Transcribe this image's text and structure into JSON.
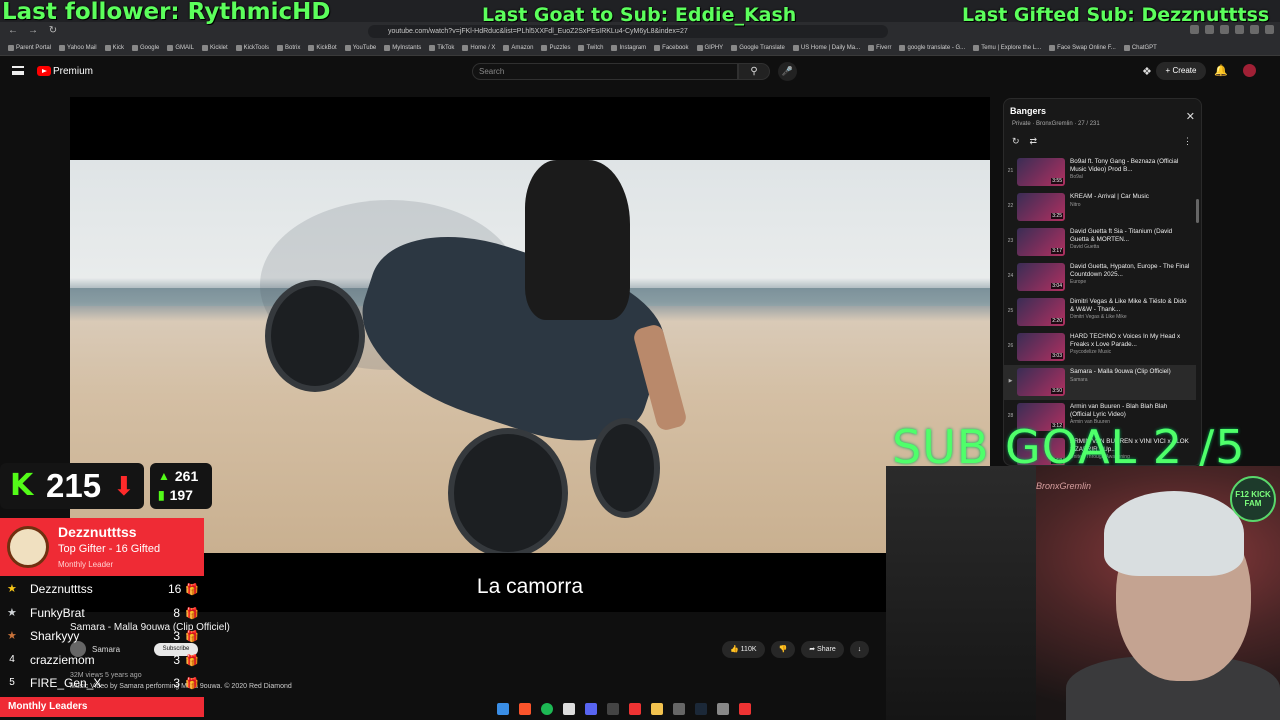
{
  "overlays": {
    "last_follower": "Last follower: RythmicHD",
    "last_goat": "Last Goat to Sub: Eddie_Kash",
    "last_gifted": "Last Gifted Sub: Dezznutttss",
    "sub_goal": "SUB GOAL  2 /5"
  },
  "browser": {
    "url": "youtube.com/watch?v=jFKl-HdRduc&list=PLhl5XXFdl_EuoZ2SxPEsIRKLu4-CyM6yL8&index=27",
    "bookmarks": [
      "Parent Portal",
      "Yahoo Mail",
      "Kick",
      "Google",
      "GMAIL",
      "Kicklet",
      "KickTools",
      "Botrix",
      "KickBot",
      "YouTube",
      "MyInstants",
      "TikTok",
      "Home / X",
      "Amazon",
      "Puzzles",
      "Twitch",
      "Instagram",
      "Facebook",
      "GIPHY",
      "Google Translate",
      "US Home | Daily Ma...",
      "Fiverr",
      "google translate - G...",
      "Temu | Explore the L...",
      "Face Swap Online F...",
      "ChatGPT"
    ]
  },
  "header": {
    "brand": "Premium",
    "search_placeholder": "Search",
    "create_label": "Create"
  },
  "player": {
    "caption": "La camorra"
  },
  "video": {
    "title": "Samara - Malla 9ouwa (Clip Officiel)",
    "channel": "Samara",
    "subscribe": "Subscribe",
    "meta": "32M views  5 years ago",
    "desc": "Music Video by Samara performing Malla 9ouwa. © 2020 Red Diamond",
    "likes": "110K",
    "share": "Share"
  },
  "playlist": {
    "title": "Bangers",
    "meta": "Private  ·  BronxGremlin  ·  27 / 231",
    "items": [
      {
        "num": "21",
        "title": "Bo9al ft. Tony Gang - Beznaza (Official Music Video) Prod B...",
        "channel": "Bo9al",
        "dur": "3:55",
        "active": false
      },
      {
        "num": "22",
        "title": "KREAM - Arrival | Car Music",
        "channel": "Nitro",
        "dur": "3:25",
        "active": false
      },
      {
        "num": "23",
        "title": "David Guetta ft Sia - Titanium (David Guetta & MORTEN...",
        "channel": "David Guetta",
        "dur": "3:17",
        "active": false
      },
      {
        "num": "24",
        "title": "David Guetta, Hypaton, Europe - The Final Countdown 2025...",
        "channel": "Europe",
        "dur": "3:04",
        "active": false
      },
      {
        "num": "25",
        "title": "Dimitri Vegas & Like Mike & Tiësto & Dido & W&W - Thank...",
        "channel": "Dimitri Vegas & Like Mike",
        "dur": "2:20",
        "active": false
      },
      {
        "num": "26",
        "title": "HARD TECHNO x Voices In My Head x Freaks x Love Parade...",
        "channel": "Psycodelize Music",
        "dur": "3:03",
        "active": false
      },
      {
        "num": "▶",
        "title": "Samara - Malla 9ouwa (Clip Officiel)",
        "channel": "Samara",
        "dur": "3:50",
        "active": true
      },
      {
        "num": "28",
        "title": "Armin van Buuren - Blah Blah Blah (Official Lyric Video)",
        "channel": "Armin van Buuren",
        "dur": "3:12",
        "active": false
      },
      {
        "num": "29",
        "title": "ARMIN VAN BUUREN x VINI VICI x ALOK x ZAFRIR - Up...",
        "channel": "United Through Awakening",
        "dur": "2:58",
        "active": false
      }
    ]
  },
  "kick": {
    "followers": "215",
    "stat_up": "261",
    "stat_bars": "197"
  },
  "webcam": {
    "badge": "F12 KICK FAM",
    "sign": "BronxGremlin"
  },
  "leaders": {
    "top_name": "Dezznutttss",
    "top_sub": "Top Gifter - 16 Gifted",
    "top_small": "Monthly Leader",
    "footer": "Monthly Leaders",
    "rows": [
      {
        "rank": "1",
        "name": "Dezznutttss",
        "count": "16",
        "star": "gold"
      },
      {
        "rank": "2",
        "name": "FunkyBrat",
        "count": "8",
        "star": "silver"
      },
      {
        "rank": "3",
        "name": "Sharkyyy",
        "count": "3",
        "star": "bronze"
      },
      {
        "rank": "4",
        "name": "crazziemom",
        "count": "3",
        "star": ""
      },
      {
        "rank": "5",
        "name": "FIRE_Gen_X",
        "count": "3",
        "star": ""
      }
    ]
  },
  "colors": {
    "overlay_green": "#5cff5c",
    "kick_green": "#53fc18",
    "leader_red": "#ef2b35"
  }
}
